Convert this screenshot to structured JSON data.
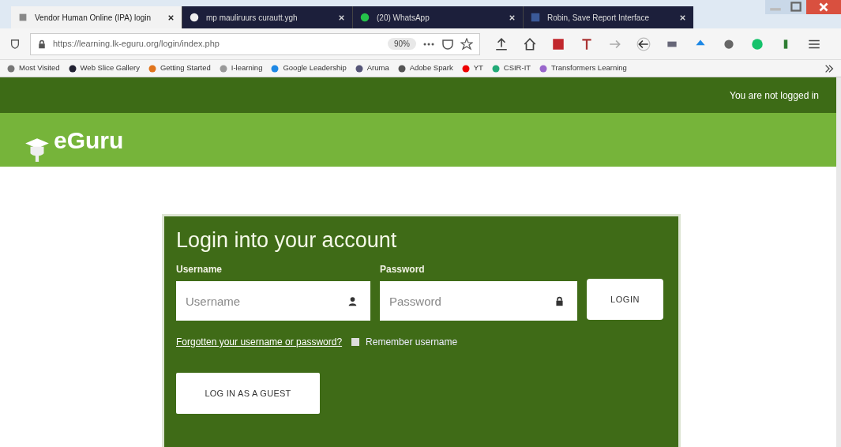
{
  "browser": {
    "tabs": [
      {
        "title": "Vendor Human Online (IPA) login",
        "selected": true
      },
      {
        "title": "mp mauliruurs curautt.ygh",
        "selected": false
      },
      {
        "title": "(20) WhatsApp",
        "selected": false
      },
      {
        "title": "Robin, Save Report Interface",
        "selected": false
      }
    ],
    "url": "https://learning.lk-eguru.org/login/index.php",
    "zoom": "90%",
    "bookmarks": [
      "Most Visited",
      "Web Slice Gallery",
      "Getting Started",
      "I-learning",
      "Google Leadership",
      "Aruma",
      "Adobe Spark",
      "YT",
      "CSIR-IT",
      "Transformers Learning"
    ]
  },
  "header": {
    "status": "You are not logged in",
    "logo": "eGuru"
  },
  "login": {
    "title": "Login into your account",
    "username_label": "Username",
    "username_placeholder": "Username",
    "password_label": "Password",
    "password_placeholder": "Password",
    "login_button": "LOGIN",
    "forgot_link": "Forgotten your username or password?",
    "remember": {
      "label": "Remember username",
      "checked": false
    },
    "guest_button": "LOG IN AS A GUEST"
  }
}
